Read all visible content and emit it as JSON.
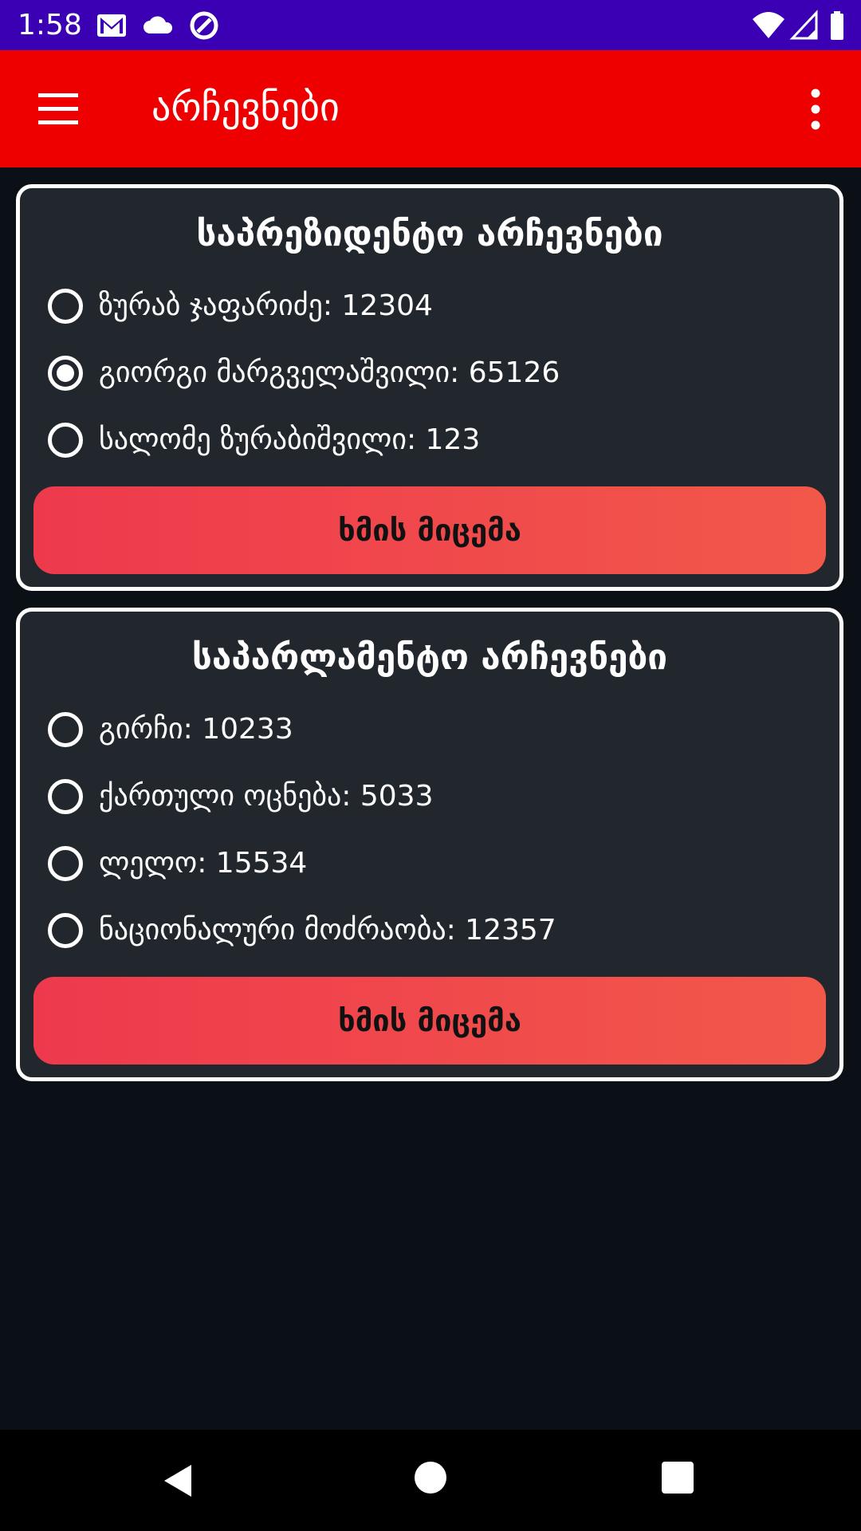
{
  "status_bar": {
    "time": "1:58",
    "icons": [
      "gmail-icon",
      "cloud-icon",
      "sync-icon",
      "wifi-icon",
      "signal-icon",
      "battery-icon"
    ]
  },
  "app_bar": {
    "title": "არჩევნები",
    "color": "#ee0000"
  },
  "cards": [
    {
      "title": "საპრეზიდენტო არჩევნები",
      "options": [
        {
          "label": "ზურაბ ჯაფარიძე: 12304",
          "selected": false
        },
        {
          "label": "გიორგი მარგველაშვილი: 65126",
          "selected": true
        },
        {
          "label": "სალომე ზურაბიშვილი: 123",
          "selected": false
        }
      ],
      "button_label": "ხმის მიცემა"
    },
    {
      "title": "საპარლამენტო არჩევნები",
      "options": [
        {
          "label": "გირჩი: 10233",
          "selected": false
        },
        {
          "label": "ქართული ოცნება: 5033",
          "selected": false
        },
        {
          "label": "ლელო: 15534",
          "selected": false
        },
        {
          "label": "ნაციონალური მოძრაობა: 12357",
          "selected": false
        }
      ],
      "button_label": "ხმის მიცემა"
    }
  ],
  "colors": {
    "status_bar": "#3b00b3",
    "background": "#0b1016",
    "card": "#22272d",
    "button_start": "#ee394d",
    "button_end": "#f2584a"
  }
}
